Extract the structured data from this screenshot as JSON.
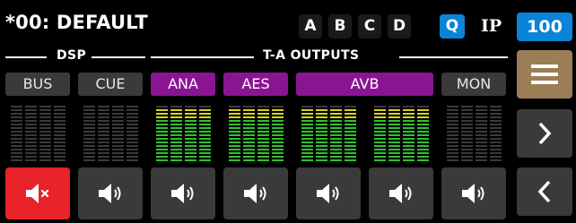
{
  "header": {
    "title": "*00: DEFAULT",
    "presets": [
      "A",
      "B",
      "C",
      "D"
    ],
    "q_label": "Q",
    "ip_label": "IP",
    "value": "100"
  },
  "sections": {
    "dsp": "DSP",
    "outputs": "T-A OUTPUTS"
  },
  "channels": [
    {
      "label": "BUS",
      "style": "grey",
      "muted": true
    },
    {
      "label": "CUE",
      "style": "grey",
      "muted": false
    },
    {
      "label": "ANA",
      "style": "purple",
      "muted": false
    },
    {
      "label": "AES",
      "style": "purple",
      "muted": false
    },
    {
      "label": "AVB",
      "style": "purple",
      "muted": false
    },
    {
      "label": "",
      "style": "",
      "muted": false
    },
    {
      "label": "MON",
      "style": "grey",
      "muted": false
    }
  ],
  "meter_levels": [
    0,
    0,
    1,
    1,
    1,
    1,
    0
  ],
  "colors": {
    "accent_blue": "#0a84d8",
    "channel_purple": "#8a1592",
    "mute_red": "#e8232a",
    "menu_tan": "#9b7e55",
    "meter_green": "#2fc12f",
    "meter_yellow": "#d8d320"
  },
  "icons": {
    "mute_active": "speaker-mute-icon",
    "mute_inactive": "speaker-icon",
    "menu": "hamburger-menu-icon",
    "next": "chevron-right-icon",
    "prev": "chevron-left-icon"
  }
}
